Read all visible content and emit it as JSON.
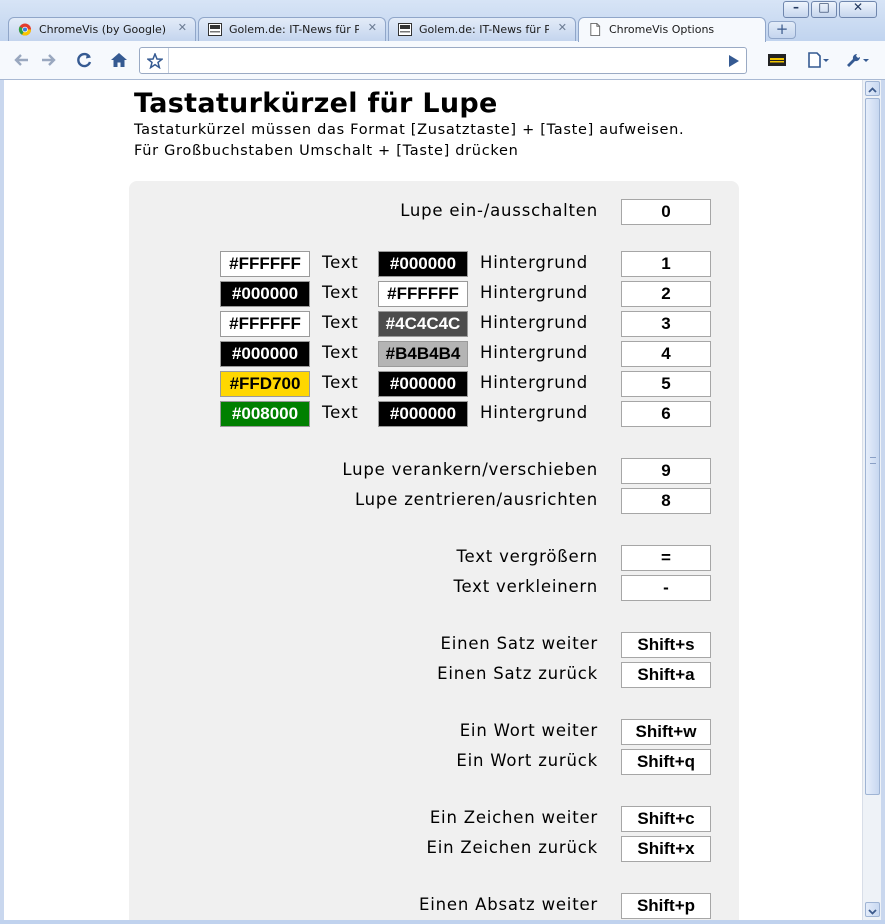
{
  "colors": {
    "panel": "#F0F0F0",
    "border": "#A6A6A6"
  },
  "tabs": [
    {
      "title": "ChromeVis (by Google) - ...",
      "icon": "chrome-icon",
      "active": false
    },
    {
      "title": "Golem.de: IT-News für P...",
      "icon": "golem-icon",
      "active": false
    },
    {
      "title": "Golem.de: IT-News für Pr...",
      "icon": "golem-icon",
      "active": false
    },
    {
      "title": "ChromeVis Options",
      "icon": "page-icon",
      "active": true
    }
  ],
  "toolbar": {
    "address": ""
  },
  "page": {
    "title": "Tastaturkürzel für Lupe",
    "intro_line1": "Tastaturkürzel müssen das Format [Zusatztaste] + [Taste] aufweisen.",
    "intro_line2": "Für Großbuchstaben Umschalt + [Taste] drücken"
  },
  "toggle": {
    "label": "Lupe ein-/ausschalten",
    "key": "0"
  },
  "color_schemes": {
    "text_word": "Text",
    "bg_word": "Hintergrund",
    "rows": [
      {
        "text_color": "#FFFFFF",
        "bg_color": "#000000",
        "key": "1"
      },
      {
        "text_color": "#000000",
        "bg_color": "#FFFFFF",
        "key": "2"
      },
      {
        "text_color": "#FFFFFF",
        "bg_color": "#4C4C4C",
        "key": "3"
      },
      {
        "text_color": "#000000",
        "bg_color": "#B4B4B4",
        "key": "4"
      },
      {
        "text_color": "#FFD700",
        "bg_color": "#000000",
        "key": "5"
      },
      {
        "text_color": "#008000",
        "bg_color": "#000000",
        "key": "6"
      }
    ]
  },
  "shortcuts": [
    {
      "label": "Lupe verankern/verschieben",
      "key": "9"
    },
    {
      "label": "Lupe zentrieren/ausrichten",
      "key": "8"
    },
    {
      "label": "Text vergrößern",
      "key": "="
    },
    {
      "label": "Text verkleinern",
      "key": "-"
    },
    {
      "label": "Einen Satz weiter",
      "key": "Shift+s"
    },
    {
      "label": "Einen Satz zurück",
      "key": "Shift+a"
    },
    {
      "label": "Ein Wort weiter",
      "key": "Shift+w"
    },
    {
      "label": "Ein Wort zurück",
      "key": "Shift+q"
    },
    {
      "label": "Ein Zeichen weiter",
      "key": "Shift+c"
    },
    {
      "label": "Ein Zeichen zurück",
      "key": "Shift+x"
    },
    {
      "label": "Einen Absatz weiter",
      "key": "Shift+p"
    }
  ]
}
